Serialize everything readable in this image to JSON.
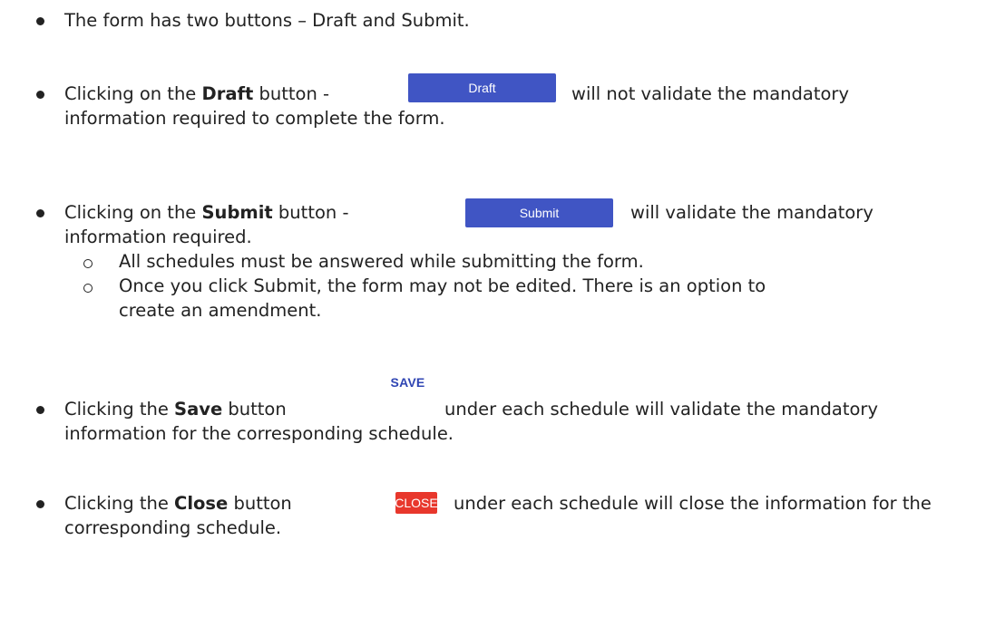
{
  "items": [
    {
      "text": "The form has two buttons – Draft and Submit."
    },
    {
      "before": "Clicking on the ",
      "bold": "Draft",
      "after": " button -",
      "tail": "will not validate the mandatory",
      "line2": "information required to complete the form.",
      "button_label": "Draft"
    },
    {
      "before": "Clicking on the ",
      "bold": "Submit",
      "after": " button -",
      "tail": "will validate the mandatory",
      "line2": "information required.",
      "button_label": "Submit",
      "subitems": [
        {
          "text": "All schedules must be answered while submitting the form."
        },
        {
          "line1": "Once you click Submit, the form may not be edited.  There is an option to",
          "line2": "create an amendment."
        }
      ]
    },
    {
      "before": "Clicking the ",
      "bold": "Save",
      "after": " button",
      "tail": "under each schedule will validate the mandatory",
      "line2": "information for the corresponding schedule.",
      "button_label": "SAVE"
    },
    {
      "before": "Clicking the ",
      "bold": "Close",
      "after": " button",
      "tail": "under each schedule will close the information for the",
      "line2": "corresponding schedule.",
      "button_label": "CLOSE"
    }
  ],
  "colors": {
    "primary_button": "#4055c4",
    "save_label": "#2f45b3",
    "close_button": "#e8372c"
  }
}
